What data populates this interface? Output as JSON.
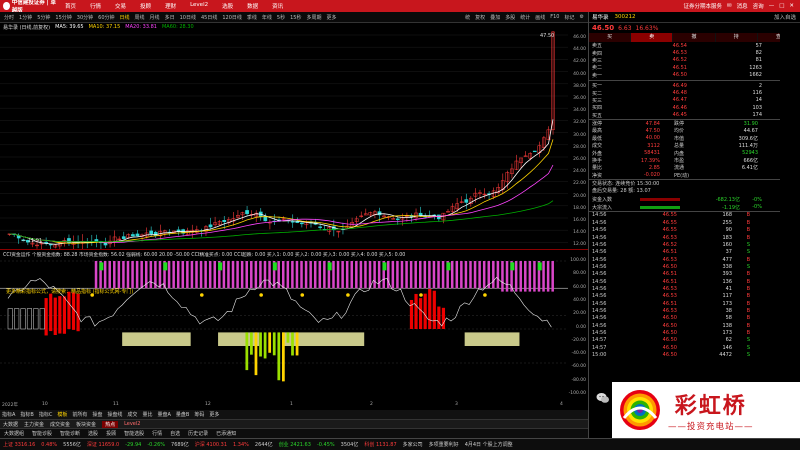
{
  "topbar": {
    "logo": "中信建投证券 | 卓越版",
    "menu": [
      "首页",
      "行情",
      "交易",
      "投顾",
      "理财",
      "Level2",
      "选股",
      "数据",
      "资讯"
    ],
    "right": [
      "证券分期本服务",
      "消息",
      "咨询"
    ]
  },
  "periodbar": {
    "items": [
      "分时",
      "1分钟",
      "5分钟",
      "15分钟",
      "30分钟",
      "60分钟",
      "日线",
      "周线",
      "月线",
      "多日",
      "10日线",
      "45日线",
      "120日线",
      "季线",
      "年线",
      "5秒",
      "15秒",
      "多周期",
      "更多"
    ],
    "active": "日线",
    "right": [
      "统",
      "复权",
      "叠加",
      "多股",
      "统计",
      "画线",
      "F10",
      "标记",
      "⚙"
    ]
  },
  "indicators": {
    "name": "易华录 (日线,前复权)",
    "ma5": "MA5: 39.65",
    "ma10": "MA10: 37.15",
    "ma20": "MA20: 33.81",
    "ma60": "MA60: 28.30"
  },
  "main_axis": [
    "46.00",
    "44.00",
    "42.00",
    "40.00",
    "38.00",
    "36.00",
    "34.00",
    "32.00",
    "30.00",
    "28.00",
    "26.00",
    "24.00",
    "22.00",
    "20.00",
    "18.00",
    "16.00",
    "14.00",
    "12.00"
  ],
  "chart_labels": {
    "high_marker": "47.50",
    "low_marker": "11.91"
  },
  "sub_indicator": {
    "text": "CCI资金运作  个股资金指数: 88.28  市场资金指数: 56.02  强弱线: 60.00  20.00  -50.00  CCI精准买点: 0.00  CCI超跌: 0.00  买入1: 0.00  买入2: 0.00  买入3: 0.00  买入4: 0.00  买入5: 0.00",
    "note": "更多精彩指标公式，请搜索：精品指标 (指标公式网-专门)"
  },
  "sub_axis": [
    "100.00",
    "80.00",
    "60.00",
    "40.00",
    "20.00",
    "0.00",
    "-20.00",
    "-40.00",
    "-60.00",
    "-80.00",
    "-100.00"
  ],
  "date_axis": [
    "2022年",
    "10",
    "11",
    "12",
    "1",
    "2",
    "3",
    "4"
  ],
  "tabs_row1": {
    "items": [
      "指标A",
      "指标B",
      "指标C",
      "模板",
      "前所有",
      "操盘",
      "操盘线",
      "成交",
      "量比",
      "量盘A",
      "量盘B",
      "筹码",
      "更多"
    ],
    "active": "模板"
  },
  "tabs_row2": {
    "items": [
      "大数据",
      "主力资金",
      "成交资金",
      "板块资金",
      "热点"
    ],
    "active": "热点",
    "right": "Level2"
  },
  "tabs_row3": [
    "大数据组",
    "智能诊股",
    "智能诊断",
    "选股",
    "投顾",
    "智能选股",
    "行情",
    "自选",
    "历史记录",
    "已添通知"
  ],
  "status": {
    "items": [
      {
        "t": "上证 3316.16",
        "c": "red"
      },
      {
        "t": "0.48%",
        "c": "red"
      },
      {
        "t": "5556亿",
        "c": "white"
      },
      {
        "t": "深证 11659.0",
        "c": "red"
      },
      {
        "t": "-29.94",
        "c": "green"
      },
      {
        "t": "-0.26%",
        "c": "green"
      },
      {
        "t": "7689亿",
        "c": "white"
      },
      {
        "t": "沪深 4100.31",
        "c": "red"
      },
      {
        "t": "1.34%",
        "c": "red"
      },
      {
        "t": "2644亿",
        "c": "white"
      },
      {
        "t": "创业 2421.63",
        "c": "green"
      },
      {
        "t": "-0.45%",
        "c": "green"
      },
      {
        "t": "3504亿",
        "c": "white"
      },
      {
        "t": "科创 1131.87",
        "c": "red"
      },
      {
        "t": "多家公司",
        "c": "white"
      },
      {
        "t": "多项重要利好",
        "c": "white"
      },
      {
        "t": "4月4日 个股上方调整",
        "c": "white"
      }
    ]
  },
  "rpanel": {
    "name": "易华录",
    "code": "300212",
    "extra": "加入自选",
    "price": "46.50",
    "change": "6.63",
    "change_pct": "16.63%",
    "tabs": [
      "买",
      "卖",
      "撤",
      "持",
      "查"
    ],
    "active_tab": "卖",
    "asks": [
      {
        "l": "卖五",
        "p": "46.54",
        "v": "57"
      },
      {
        "l": "卖四",
        "p": "46.53",
        "v": "82"
      },
      {
        "l": "卖三",
        "p": "46.52",
        "v": "81"
      },
      {
        "l": "卖二",
        "p": "46.51",
        "v": "1263"
      },
      {
        "l": "卖一",
        "p": "46.50",
        "v": "1662"
      }
    ],
    "bids": [
      {
        "l": "买一",
        "p": "46.49",
        "v": "2"
      },
      {
        "l": "买二",
        "p": "46.48",
        "v": "116"
      },
      {
        "l": "买三",
        "p": "46.47",
        "v": "14"
      },
      {
        "l": "买四",
        "p": "46.46",
        "v": "103"
      },
      {
        "l": "买五",
        "p": "46.45",
        "v": "174"
      }
    ],
    "stats": [
      {
        "l1": "涨停",
        "v1": "47.84",
        "l2": "跌停",
        "v2": "31.90",
        "c2": "green"
      },
      {
        "l1": "最高",
        "v1": "47.50",
        "l2": "均价",
        "v2": "44.67",
        "c2": "white"
      },
      {
        "l1": "最低",
        "v1": "40.00",
        "l2": "市值",
        "v2": "309.6亿",
        "c2": "white"
      },
      {
        "l1": "成交",
        "v1": "3112",
        "l2": "总量",
        "v2": "111.4万",
        "c2": "white"
      },
      {
        "l1": "外盘",
        "v1": "58431",
        "l2": "内盘",
        "v2": "52943",
        "c2": "green"
      },
      {
        "l1": "换手",
        "v1": "17.39%",
        "l2": "市盈",
        "v2": "666亿",
        "c2": "white"
      },
      {
        "l1": "量比",
        "v1": "2.85",
        "l2": "流通",
        "v2": "6.41亿",
        "c2": "white"
      },
      {
        "l1": "净资",
        "v1": "-0.020",
        "l2": "PE(动)",
        "v2": "",
        "c2": "white"
      }
    ],
    "info1": "交易状态: 连续竞价 15:30:00",
    "info2": "盘后交易量: 28  额: 13.07",
    "flow": [
      {
        "l": "资金入数",
        "v": "-682.13亿",
        "pct": "-0%",
        "bar": "#8b0000"
      },
      {
        "l": "大宗流入",
        "v": "-1.19亿",
        "pct": "-0%",
        "bar": "#11a011"
      }
    ],
    "ticks": [
      {
        "t": "14:56",
        "p": "46.55",
        "v": "168",
        "n": "B"
      },
      {
        "t": "14:56",
        "p": "46.55",
        "v": "255",
        "n": "B"
      },
      {
        "t": "14:56",
        "p": "46.55",
        "v": "90",
        "n": "B"
      },
      {
        "t": "14:56",
        "p": "46.53",
        "v": "183",
        "n": "B"
      },
      {
        "t": "14:56",
        "p": "46.52",
        "v": "160",
        "n": "S"
      },
      {
        "t": "14:56",
        "p": "46.51",
        "v": "37",
        "n": "S"
      },
      {
        "t": "14:56",
        "p": "46.53",
        "v": "477",
        "n": "B"
      },
      {
        "t": "14:56",
        "p": "46.50",
        "v": "338",
        "n": "S"
      },
      {
        "t": "14:56",
        "p": "46.51",
        "v": "393",
        "n": "B"
      },
      {
        "t": "14:56",
        "p": "46.51",
        "v": "136",
        "n": "B"
      },
      {
        "t": "14:56",
        "p": "46.53",
        "v": "41",
        "n": "B"
      },
      {
        "t": "14:56",
        "p": "46.53",
        "v": "117",
        "n": "B"
      },
      {
        "t": "14:56",
        "p": "46.51",
        "v": "173",
        "n": "B"
      },
      {
        "t": "14:56",
        "p": "46.53",
        "v": "38",
        "n": "B"
      },
      {
        "t": "14:56",
        "p": "46.50",
        "v": "58",
        "n": "B"
      },
      {
        "t": "14:56",
        "p": "46.50",
        "v": "138",
        "n": "B"
      },
      {
        "t": "14:56",
        "p": "46.50",
        "v": "173",
        "n": "B"
      },
      {
        "t": "14:57",
        "p": "46.50",
        "v": "62",
        "n": "S"
      },
      {
        "t": "14:57",
        "p": "46.50",
        "v": "146",
        "n": "S"
      },
      {
        "t": "15:00",
        "p": "46.50",
        "v": "4472",
        "n": "S"
      }
    ]
  },
  "ad": {
    "big": "彩虹桥",
    "small": "——投资充电站——"
  },
  "colors": {
    "up": "#ff3b3b",
    "down": "#2bd52b",
    "brand": "#c8161d",
    "magenta": "#d946c8",
    "ma5": "#ffffff",
    "ma10": "#ffd400",
    "ma20": "#ff44ff",
    "ma60": "#00b000"
  }
}
